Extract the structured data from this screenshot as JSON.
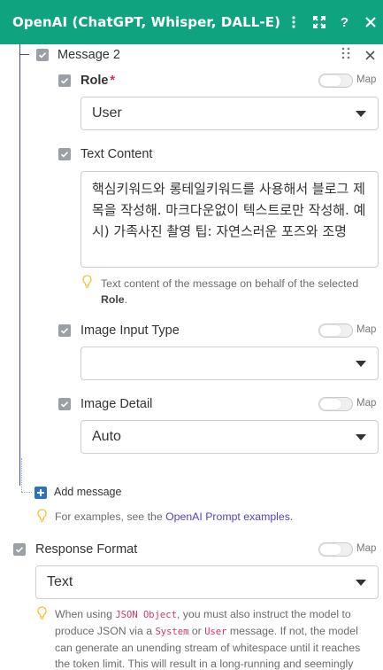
{
  "header": {
    "title": "OpenAI (ChatGPT, Whisper, DALL-E)"
  },
  "message": {
    "title": "Message 2",
    "role": {
      "label": "Role",
      "required_mark": "*",
      "map": "Map",
      "value": "User"
    },
    "text_content": {
      "label": "Text Content",
      "value": "핵심키워드와 롱테일키워드를 사용해서 블로그 제목을 작성해. 마크다운없이 텍스트로만 작성해. 예시) 가족사진 촬영 팁: 자연스러운 포즈와 조명",
      "hint_text": "Text content of the message on behalf of the selected ",
      "hint_bold": "Role",
      "hint_end": "."
    },
    "image_input_type": {
      "label": "Image Input Type",
      "map": "Map",
      "value": ""
    },
    "image_detail": {
      "label": "Image Detail",
      "map": "Map",
      "value": "Auto"
    }
  },
  "add_message": {
    "label": "Add message"
  },
  "examples_hint": {
    "pre": "For examples, see the ",
    "link": "OpenAI Prompt examples",
    "post": "."
  },
  "response_format": {
    "label": "Response Format",
    "map": "Map",
    "value": "Text",
    "hint": {
      "p1": "When using ",
      "code1": "JSON Object",
      "p2": ", you must also instruct the model to produce JSON via a ",
      "code2": "System",
      "p3": " or ",
      "code3": "User",
      "p4": " message. If not, the model can generate an unending stream of whitespace until it reaches the token limit. This will result in a long-running and seemingly"
    }
  },
  "icons": {
    "header": [
      "more-vertical-icon",
      "expand-icon",
      "help-icon",
      "close-icon"
    ],
    "accent": "#10a37f"
  }
}
